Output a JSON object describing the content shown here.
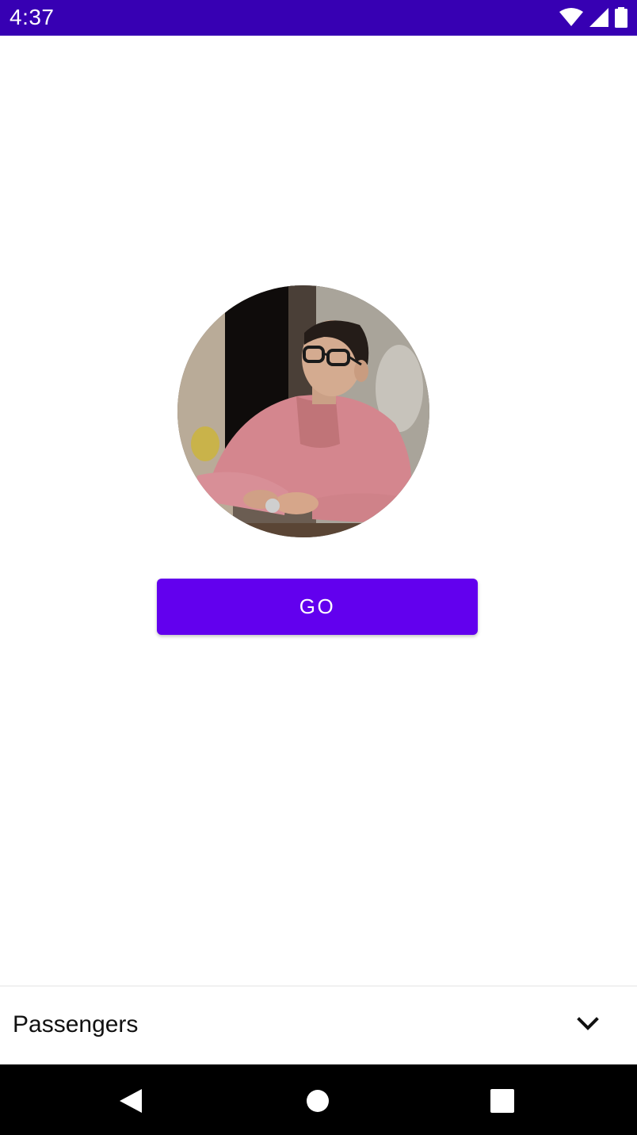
{
  "status_bar": {
    "time": "4:37",
    "background": "#3700b3",
    "icons": [
      "wifi-icon",
      "cellular-signal-icon",
      "battery-icon"
    ]
  },
  "profile": {
    "avatar_icon": "profile-photo"
  },
  "actions": {
    "go_label": "GO",
    "accent": "#6200ee"
  },
  "bottom_sheet": {
    "label": "Passengers",
    "icon": "chevron-down-icon"
  },
  "nav_bar": {
    "icons": [
      "back-icon",
      "home-icon",
      "recents-icon"
    ]
  }
}
